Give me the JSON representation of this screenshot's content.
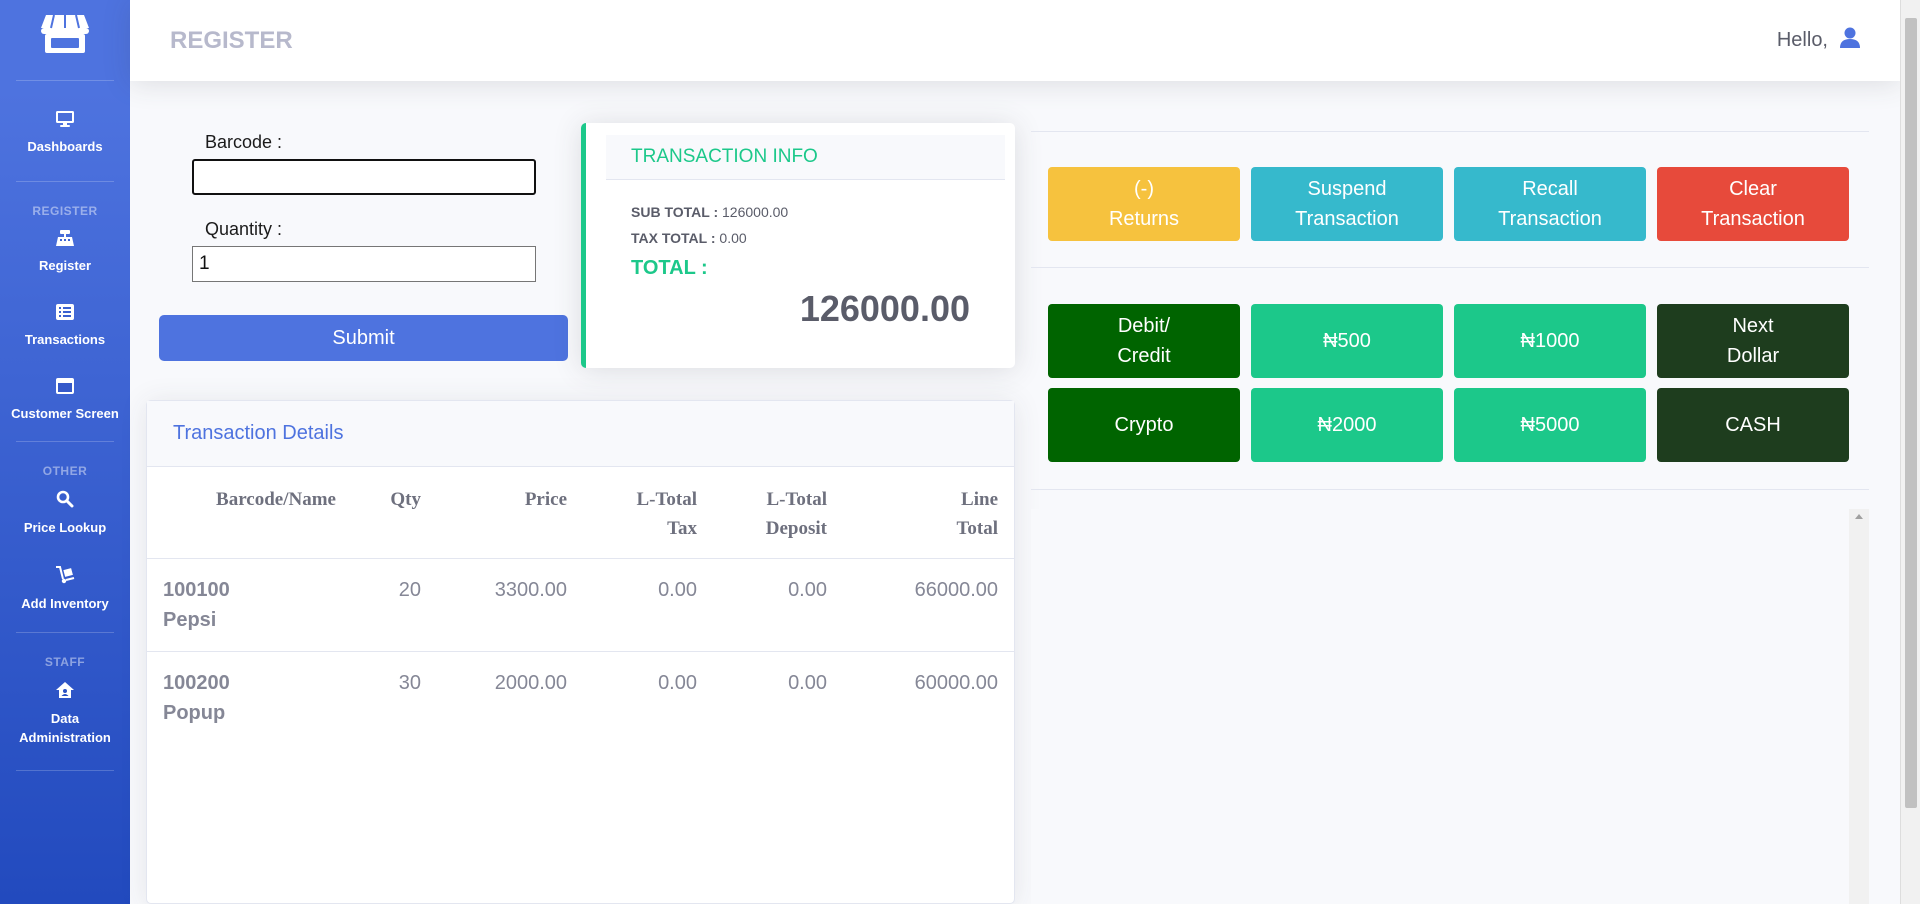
{
  "sidebar": {
    "logo_icon": "store-icon",
    "items": [
      {
        "label": "Dashboards",
        "icon": "desktop-icon"
      },
      {
        "label": "Register",
        "icon": "cash-register-icon"
      },
      {
        "label": "Transactions",
        "icon": "list-icon"
      },
      {
        "label": "Customer Screen",
        "icon": "window-icon"
      },
      {
        "label": "Price Lookup",
        "icon": "search-icon"
      },
      {
        "label": "Add Inventory",
        "icon": "dolly-icon"
      },
      {
        "label": "Data Administration",
        "icon": "house-user-icon"
      }
    ],
    "headings": {
      "register": "REGISTER",
      "other": "OTHER",
      "staff": "STAFF"
    }
  },
  "topbar": {
    "title": "REGISTER",
    "greeting": "Hello,",
    "user_icon": "user-icon"
  },
  "form": {
    "barcode_label": "Barcode :",
    "barcode_value": "",
    "quantity_label": "Quantity :",
    "quantity_value": "1",
    "submit_label": "Submit"
  },
  "transaction_info": {
    "title": "TRANSACTION INFO",
    "sub_total_label": "SUB TOTAL :",
    "sub_total": "126000.00",
    "tax_total_label": "TAX TOTAL :",
    "tax_total": "0.00",
    "total_label": "TOTAL :",
    "total": "126000.00"
  },
  "transaction_details": {
    "title": "Transaction Details",
    "columns": [
      "Barcode/Name",
      "Qty",
      "Price",
      "L-Total Tax",
      "L-Total Deposit",
      "Line Total"
    ],
    "rows": [
      {
        "barcode": "100100",
        "name": "Pepsi",
        "qty": "20",
        "price": "3300.00",
        "tax": "0.00",
        "deposit": "0.00",
        "line_total": "66000.00"
      },
      {
        "barcode": "100200",
        "name": "Popup",
        "qty": "30",
        "price": "2000.00",
        "tax": "0.00",
        "deposit": "0.00",
        "line_total": "60000.00"
      }
    ]
  },
  "actions": {
    "returns": "(-)\nReturns",
    "suspend": "Suspend\nTransaction",
    "recall": "Recall\nTransaction",
    "clear": "Clear\nTransaction"
  },
  "payments": {
    "debit_credit": "Debit/\nCredit",
    "n500": "₦500",
    "n1000": "₦1000",
    "next_dollar": "Next\nDollar",
    "crypto": "Crypto",
    "n2000": "₦2000",
    "n5000": "₦5000",
    "cash": "CASH"
  },
  "colors": {
    "primary": "#4e73df",
    "success": "#1cc88a",
    "info": "#36b9cc",
    "warning": "#f6c23e",
    "danger": "#e74a3b",
    "dark_green": "#006400",
    "darker_green": "#1e3d1e"
  }
}
